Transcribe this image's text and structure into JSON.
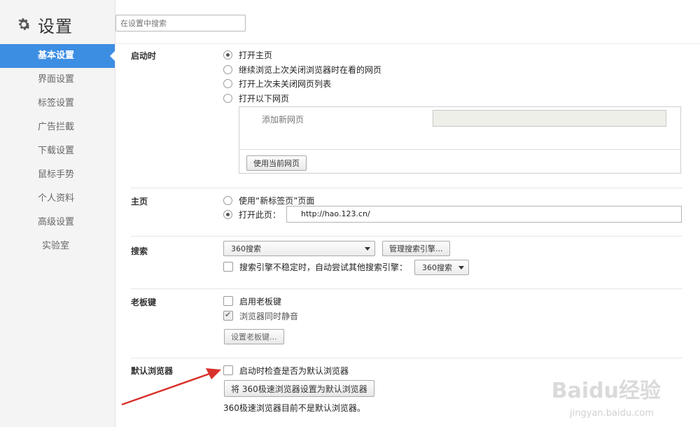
{
  "app": {
    "title": "设置"
  },
  "search": {
    "placeholder": "在设置中搜索"
  },
  "sidebar": {
    "items": [
      {
        "label": "基本设置"
      },
      {
        "label": "界面设置"
      },
      {
        "label": "标签设置"
      },
      {
        "label": "广告拦截"
      },
      {
        "label": "下载设置"
      },
      {
        "label": "鼠标手势"
      },
      {
        "label": "个人资料"
      },
      {
        "label": "高级设置"
      },
      {
        "label": "实验室"
      }
    ]
  },
  "startup": {
    "title": "启动时",
    "options": [
      "打开主页",
      "继续浏览上次关闭浏览器时在看的网页",
      "打开上次未关闭网页列表",
      "打开以下网页"
    ],
    "add_page": "添加新网页",
    "use_current": "使用当前网页"
  },
  "homepage": {
    "title": "主页",
    "option_newtab": "使用“新标签页”页面",
    "option_open": "打开此页：",
    "url": "http://hao.123.cn/"
  },
  "search_section": {
    "title": "搜索",
    "engine": "360搜索",
    "manage": "管理搜索引擎...",
    "fallback_label": "搜索引擎不稳定时，自动尝试其他搜索引擎：",
    "fallback_engine": "360搜索"
  },
  "boss_key": {
    "title": "老板键",
    "enable": "启用老板键",
    "mute": "浏览器同时静音",
    "set": "设置老板键..."
  },
  "default_browser": {
    "title": "默认浏览器",
    "check_label": "启动时检查是否为默认浏览器",
    "set_button": "将 360极速浏览器设置为默认浏览器",
    "status": "360极速浏览器目前不是默认浏览器。"
  },
  "watermark": {
    "brand": "Baidu经验",
    "url": "jingyan.baidu.com"
  },
  "colors": {
    "accent": "#3c8ee3",
    "arrow": "#d9312b"
  }
}
